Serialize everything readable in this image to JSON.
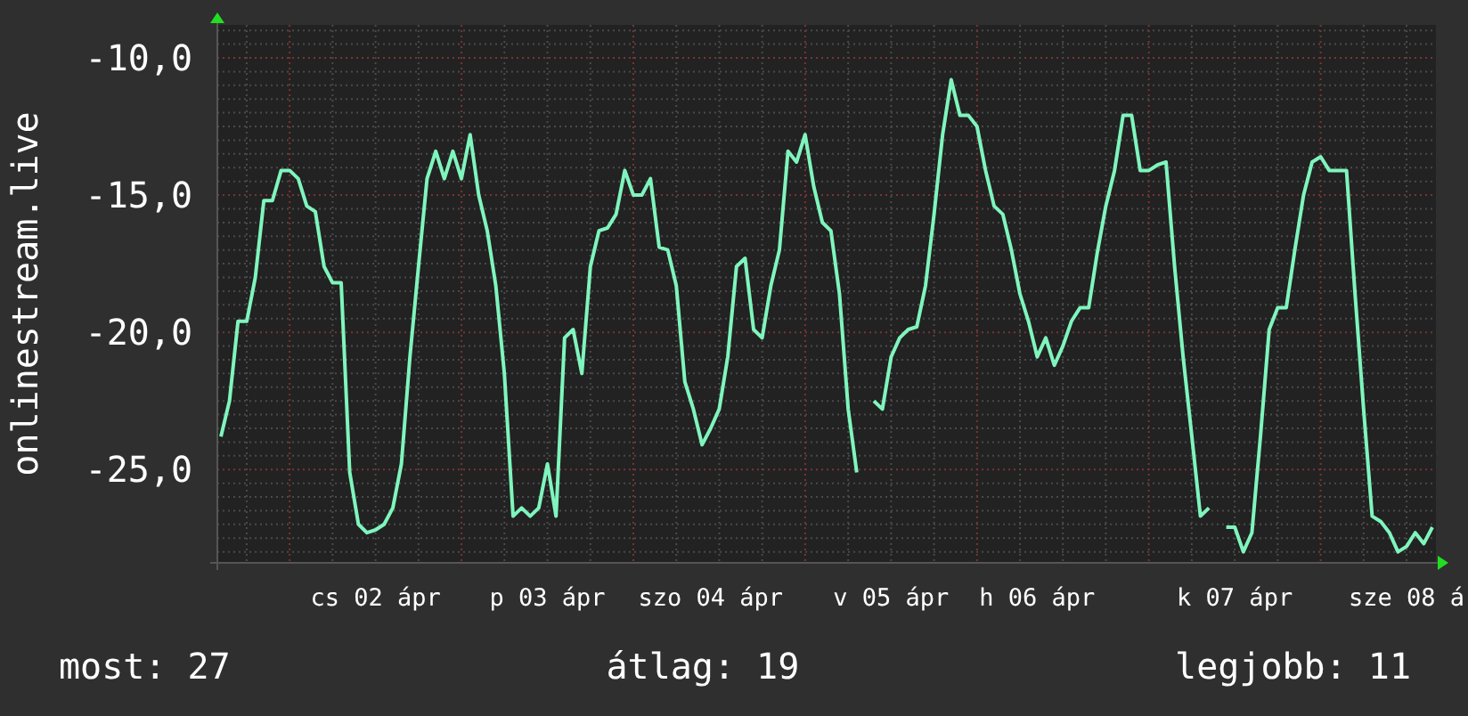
{
  "chart": {
    "chart_data": {
      "type": "line",
      "ylabel": "onlinestream.live",
      "categories": [
        null,
        null,
        null,
        null,
        null,
        null,
        null,
        null,
        null,
        null,
        null,
        null,
        null,
        null,
        null,
        null,
        null,
        null,
        "cs 02 ápr",
        null,
        null,
        null,
        null,
        null,
        null,
        null,
        null,
        null,
        null,
        null,
        null,
        null,
        null,
        null,
        null,
        null,
        null,
        null,
        "p 03 ápr",
        null,
        null,
        null,
        null,
        null,
        null,
        null,
        null,
        null,
        null,
        null,
        null,
        null,
        null,
        null,
        null,
        null,
        null,
        "szo 04 ápr",
        null,
        null,
        null,
        null,
        null,
        null,
        null,
        null,
        null,
        null,
        null,
        null,
        null,
        null,
        null,
        null,
        null,
        null,
        null,
        null,
        "v 05 ápr",
        null,
        null,
        null,
        null,
        null,
        null,
        null,
        null,
        null,
        null,
        null,
        null,
        null,
        null,
        null,
        null,
        "h 06 ápr",
        null,
        null,
        null,
        null,
        null,
        null,
        null,
        null,
        null,
        null,
        null,
        null,
        null,
        null,
        null,
        null,
        null,
        null,
        null,
        null,
        null,
        null,
        "k 07 ápr",
        null,
        null,
        null,
        null,
        null,
        null,
        null,
        null,
        null,
        null,
        null,
        null,
        null,
        null,
        null,
        null,
        null,
        null,
        null,
        "sze 08 á",
        null,
        null,
        null
      ],
      "series": [
        {
          "color": "#7ff5bd",
          "values": [
            -23.8,
            -22.5,
            -19.6,
            -19.6,
            -18.0,
            -15.2,
            -15.2,
            -14.1,
            -14.1,
            -14.4,
            -15.4,
            -15.6,
            -17.6,
            -18.2,
            -18.2,
            -25.1,
            -27.0,
            -27.3,
            -27.2,
            -27.0,
            -26.4,
            -24.8,
            -20.9,
            -17.6,
            -14.4,
            -13.4,
            -14.4,
            -13.4,
            -14.4,
            -12.8,
            -15.0,
            -16.3,
            -18.3,
            -21.5,
            -26.7,
            -26.4,
            -26.7,
            -26.4,
            -24.8,
            -26.7,
            -20.2,
            -19.9,
            -21.5,
            -17.6,
            -16.3,
            -16.2,
            -15.7,
            -14.1,
            -15.0,
            -15.0,
            -14.4,
            -16.9,
            -17.0,
            -18.3,
            -21.8,
            -22.8,
            -24.1,
            -23.5,
            -22.8,
            -20.9,
            -17.6,
            -17.3,
            -19.9,
            -20.2,
            -18.3,
            -17.0,
            -13.4,
            -13.8,
            -12.8,
            -14.7,
            -16.0,
            -16.3,
            -18.6,
            -22.8,
            -25.1,
            null,
            -22.5,
            -22.8,
            -20.9,
            -20.2,
            -19.9,
            -19.8,
            -18.3,
            -15.7,
            -12.8,
            -10.8,
            -12.1,
            -12.1,
            -12.5,
            -14.1,
            -15.4,
            -15.7,
            -17.0,
            -18.6,
            -19.6,
            -20.9,
            -20.2,
            -21.2,
            -20.5,
            -19.6,
            -19.1,
            -19.1,
            -17.1,
            -15.4,
            -14.1,
            -12.1,
            -12.1,
            -14.1,
            -14.1,
            -13.9,
            -13.8,
            -17.6,
            -20.9,
            -23.8,
            -26.7,
            -26.4,
            null,
            -27.1,
            -27.1,
            -28.0,
            -27.3,
            -23.8,
            -19.9,
            -19.1,
            -19.1,
            -17.0,
            -15.0,
            -13.8,
            -13.6,
            -14.1,
            -14.1,
            -14.1,
            -18.6,
            -22.8,
            -26.7,
            -26.9,
            -27.3,
            -28.0,
            -27.8,
            -27.3,
            -27.7,
            -27.1
          ]
        }
      ],
      "ylim": [
        -28.4,
        -8.8
      ],
      "grid": true,
      "yticks": [
        {
          "value": -10,
          "label": "-10,0"
        },
        {
          "value": -15,
          "label": "-15,0"
        },
        {
          "value": -20,
          "label": "-20,0"
        },
        {
          "value": -25,
          "label": "-25,0"
        }
      ]
    }
  },
  "stats": [
    {
      "label": "most: 27"
    },
    {
      "label": "átlag: 19"
    },
    {
      "label": "legjobb: 11"
    }
  ]
}
